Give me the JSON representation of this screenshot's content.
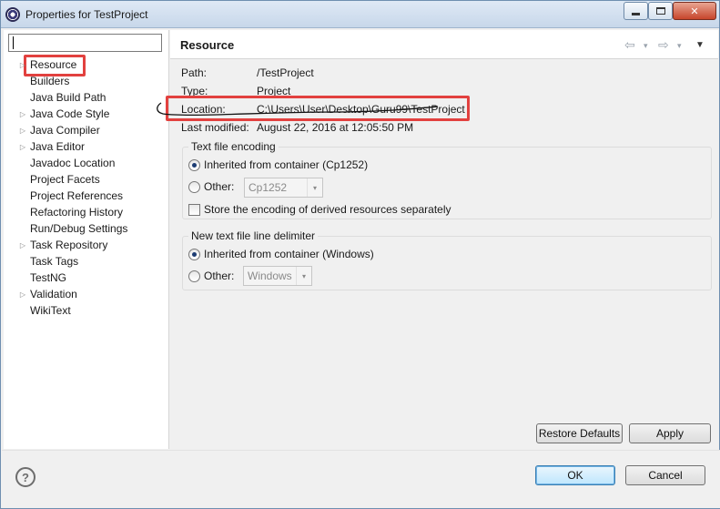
{
  "window": {
    "title": "Properties for TestProject"
  },
  "filter": {
    "value": ""
  },
  "tree": {
    "items": [
      {
        "label": "Resource",
        "expandable": true
      },
      {
        "label": "Builders",
        "expandable": false
      },
      {
        "label": "Java Build Path",
        "expandable": false
      },
      {
        "label": "Java Code Style",
        "expandable": true
      },
      {
        "label": "Java Compiler",
        "expandable": true
      },
      {
        "label": "Java Editor",
        "expandable": true
      },
      {
        "label": "Javadoc Location",
        "expandable": false
      },
      {
        "label": "Project Facets",
        "expandable": false
      },
      {
        "label": "Project References",
        "expandable": false
      },
      {
        "label": "Refactoring History",
        "expandable": false
      },
      {
        "label": "Run/Debug Settings",
        "expandable": false
      },
      {
        "label": "Task Repository",
        "expandable": true
      },
      {
        "label": "Task Tags",
        "expandable": false
      },
      {
        "label": "TestNG",
        "expandable": false
      },
      {
        "label": "Validation",
        "expandable": true
      },
      {
        "label": "WikiText",
        "expandable": false
      }
    ]
  },
  "page": {
    "title": "Resource",
    "properties": {
      "path_label": "Path:",
      "path_value": "/TestProject",
      "type_label": "Type:",
      "type_value": "Project",
      "location_label": "Location:",
      "location_value": "C:\\Users\\User\\Desktop\\Guru99\\TestProject",
      "modified_label": "Last modified:",
      "modified_value": "August 22, 2016 at 12:05:50 PM"
    },
    "encoding": {
      "title": "Text file encoding",
      "inherited_label": "Inherited from container (Cp1252)",
      "other_label": "Other:",
      "other_value": "Cp1252",
      "store_label": "Store the encoding of derived resources separately"
    },
    "delimiter": {
      "title": "New text file line delimiter",
      "inherited_label": "Inherited from container (Windows)",
      "other_label": "Other:",
      "other_value": "Windows"
    },
    "restore_defaults_label": "Restore Defaults",
    "apply_label": "Apply"
  },
  "footer": {
    "ok_label": "OK",
    "cancel_label": "Cancel"
  },
  "icons": {
    "help": "?",
    "back": "⇦",
    "forward": "⇨",
    "dropdown": "▾",
    "view_menu": "▼",
    "tree_twisty": "▷"
  },
  "colors": {
    "highlight_box": "#e2413f",
    "selected_radio": "#1c3c73"
  }
}
